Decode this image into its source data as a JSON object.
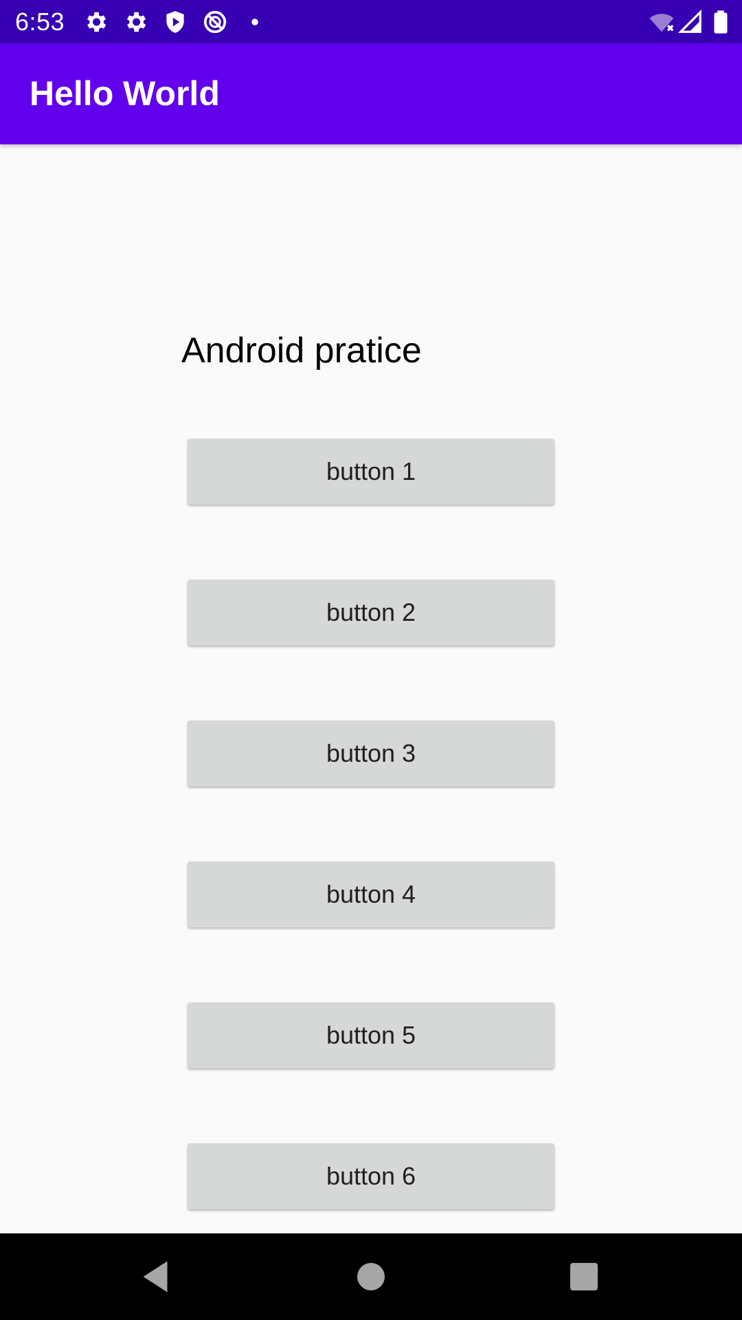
{
  "status_bar": {
    "time": "6:53",
    "left_icons": [
      "gear-icon",
      "gear-icon",
      "shield-play-icon",
      "no-data-icon",
      "dot-icon"
    ],
    "right_icons": [
      "wifi-off-icon",
      "cell-signal-icon",
      "battery-full-icon"
    ],
    "background": "#3700b3"
  },
  "app_bar": {
    "title": "Hello World",
    "background": "#6200ee"
  },
  "main": {
    "heading": "Android pratice",
    "buttons": [
      {
        "label": "button 1"
      },
      {
        "label": "button 2"
      },
      {
        "label": "button 3"
      },
      {
        "label": "button 4"
      },
      {
        "label": "button 5"
      },
      {
        "label": "button 6"
      }
    ]
  },
  "nav_bar": {
    "icons": [
      "back-icon",
      "home-icon",
      "recents-icon"
    ]
  }
}
